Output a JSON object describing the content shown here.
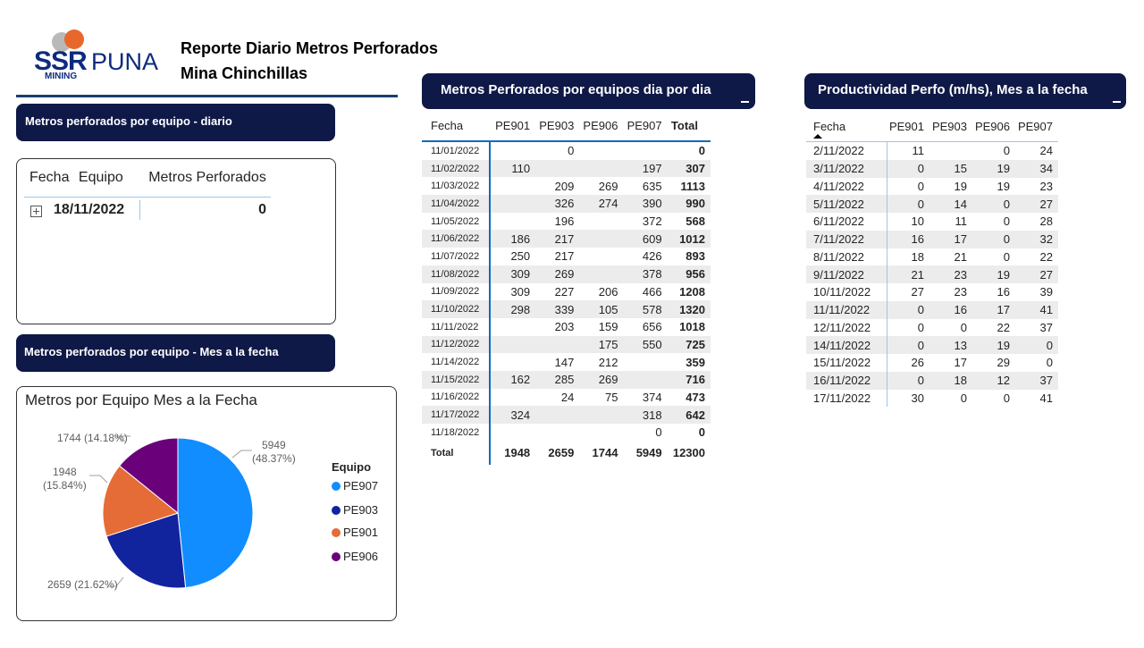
{
  "brand": {
    "name_bold": "SSR",
    "name_light": "PUNA",
    "sub": "MINING",
    "colors": {
      "orange": "#e8672a",
      "gray": "#b7b7b7",
      "navy": "#0e2a7d"
    }
  },
  "report": {
    "title_line1": "Reporte Diario Metros Perforados",
    "title_line2": "Mina Chinchillas"
  },
  "left_panel": {
    "daily_header": "Metros perforados por equipo - diario",
    "daily_table": {
      "columns": [
        "Fecha",
        "Equipo",
        "Metros Perforados"
      ],
      "row": {
        "fecha": "18/11/2022",
        "metros": "0"
      }
    },
    "month_header": "Metros perforados por equipo - Mes a la fecha",
    "pie_title": "Metros por Equipo Mes a la Fecha"
  },
  "daily_table": {
    "header": "Metros Perforados por equipos dia por dia",
    "columns": [
      "Fecha",
      "PE901",
      "PE903",
      "PE906",
      "PE907",
      "Total"
    ],
    "rows": [
      [
        "11/01/2022",
        "",
        "0",
        "",
        "",
        "0"
      ],
      [
        "11/02/2022",
        "110",
        "",
        "",
        "197",
        "307"
      ],
      [
        "11/03/2022",
        "",
        "209",
        "269",
        "635",
        "1113"
      ],
      [
        "11/04/2022",
        "",
        "326",
        "274",
        "390",
        "990"
      ],
      [
        "11/05/2022",
        "",
        "196",
        "",
        "372",
        "568"
      ],
      [
        "11/06/2022",
        "186",
        "217",
        "",
        "609",
        "1012"
      ],
      [
        "11/07/2022",
        "250",
        "217",
        "",
        "426",
        "893"
      ],
      [
        "11/08/2022",
        "309",
        "269",
        "",
        "378",
        "956"
      ],
      [
        "11/09/2022",
        "309",
        "227",
        "206",
        "466",
        "1208"
      ],
      [
        "11/10/2022",
        "298",
        "339",
        "105",
        "578",
        "1320"
      ],
      [
        "11/11/2022",
        "",
        "203",
        "159",
        "656",
        "1018"
      ],
      [
        "11/12/2022",
        "",
        "",
        "175",
        "550",
        "725"
      ],
      [
        "11/14/2022",
        "",
        "147",
        "212",
        "",
        "359"
      ],
      [
        "11/15/2022",
        "162",
        "285",
        "269",
        "",
        "716"
      ],
      [
        "11/16/2022",
        "",
        "24",
        "75",
        "374",
        "473"
      ],
      [
        "11/17/2022",
        "324",
        "",
        "",
        "318",
        "642"
      ],
      [
        "11/18/2022",
        "",
        "",
        "",
        "0",
        "0"
      ]
    ],
    "total": [
      "Total",
      "1948",
      "2659",
      "1744",
      "5949",
      "12300"
    ]
  },
  "productivity_table": {
    "header": "Productividad Perfo (m/hs), Mes a la fecha",
    "columns": [
      "Fecha",
      "PE901",
      "PE903",
      "PE906",
      "PE907"
    ],
    "rows": [
      [
        "2/11/2022",
        "11",
        "",
        "0",
        "24"
      ],
      [
        "3/11/2022",
        "0",
        "15",
        "19",
        "34"
      ],
      [
        "4/11/2022",
        "0",
        "19",
        "19",
        "23"
      ],
      [
        "5/11/2022",
        "0",
        "14",
        "0",
        "27"
      ],
      [
        "6/11/2022",
        "10",
        "11",
        "0",
        "28"
      ],
      [
        "7/11/2022",
        "16",
        "17",
        "0",
        "32"
      ],
      [
        "8/11/2022",
        "18",
        "21",
        "0",
        "22"
      ],
      [
        "9/11/2022",
        "21",
        "23",
        "19",
        "27"
      ],
      [
        "10/11/2022",
        "27",
        "23",
        "16",
        "39"
      ],
      [
        "11/11/2022",
        "0",
        "16",
        "17",
        "41"
      ],
      [
        "12/11/2022",
        "0",
        "0",
        "22",
        "37"
      ],
      [
        "14/11/2022",
        "0",
        "13",
        "19",
        "0"
      ],
      [
        "15/11/2022",
        "26",
        "17",
        "29",
        "0"
      ],
      [
        "16/11/2022",
        "0",
        "18",
        "12",
        "37"
      ],
      [
        "17/11/2022",
        "30",
        "0",
        "0",
        "41"
      ]
    ]
  },
  "chart_data": {
    "type": "pie",
    "title": "Metros por Equipo Mes a la Fecha",
    "legend_title": "Equipo",
    "legend_position": "right",
    "slices": [
      {
        "name": "PE907",
        "value": 5949,
        "label": "5949",
        "pct": "(48.37%)",
        "color": "#118dff"
      },
      {
        "name": "PE903",
        "value": 2659,
        "label": "2659 (21.62%)",
        "pct": "",
        "color": "#12239e"
      },
      {
        "name": "PE901",
        "value": 1948,
        "label": "1948",
        "pct": "(15.84%)",
        "color": "#e66c37"
      },
      {
        "name": "PE906",
        "value": 1744,
        "label": "1744 (14.18%)",
        "pct": "",
        "color": "#6b007b"
      }
    ]
  }
}
